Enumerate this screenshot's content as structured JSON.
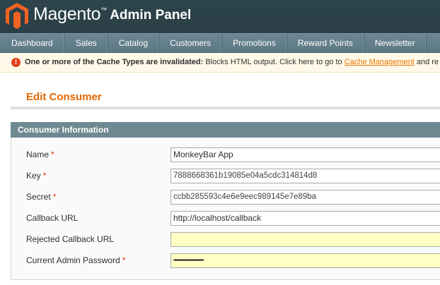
{
  "header": {
    "brand": "Magento",
    "trademark": "™",
    "panel": "Admin Panel",
    "logo_icon": "magento-logo-icon",
    "colors": {
      "logo": "#f26322",
      "header_bg": "#2d444c"
    }
  },
  "nav": {
    "items": [
      {
        "label": "Dashboard"
      },
      {
        "label": "Sales"
      },
      {
        "label": "Catalog"
      },
      {
        "label": "Customers"
      },
      {
        "label": "Promotions"
      },
      {
        "label": "Reward Points"
      },
      {
        "label": "Newsletter"
      }
    ]
  },
  "notice": {
    "icon": "error-icon",
    "icon_glyph": "!",
    "bold": "One or more of the Cache Types are invalidated:",
    "text": " Blocks HTML output. Click here to go to ",
    "link": "Cache Management",
    "tail": " and re"
  },
  "page": {
    "title": "Edit Consumer",
    "accent": "#e26703"
  },
  "fieldset": {
    "legend": "Consumer Information",
    "required_marker": "*",
    "fields": [
      {
        "label": "Name",
        "required": true,
        "value": "MonkeyBar App"
      },
      {
        "label": "Key",
        "required": true,
        "value": "7888668361b19085e04a5cdc314814d8"
      },
      {
        "label": "Secret",
        "required": true,
        "value": "ccbb285593c4e6e9eec989145e7e89ba"
      },
      {
        "label": "Callback URL",
        "required": false,
        "value": "http://localhost/callback"
      },
      {
        "label": "Rejected Callback URL",
        "required": false,
        "value": ""
      },
      {
        "label": "Current Admin Password",
        "required": true,
        "value": "•••••••••••••••••"
      }
    ]
  }
}
